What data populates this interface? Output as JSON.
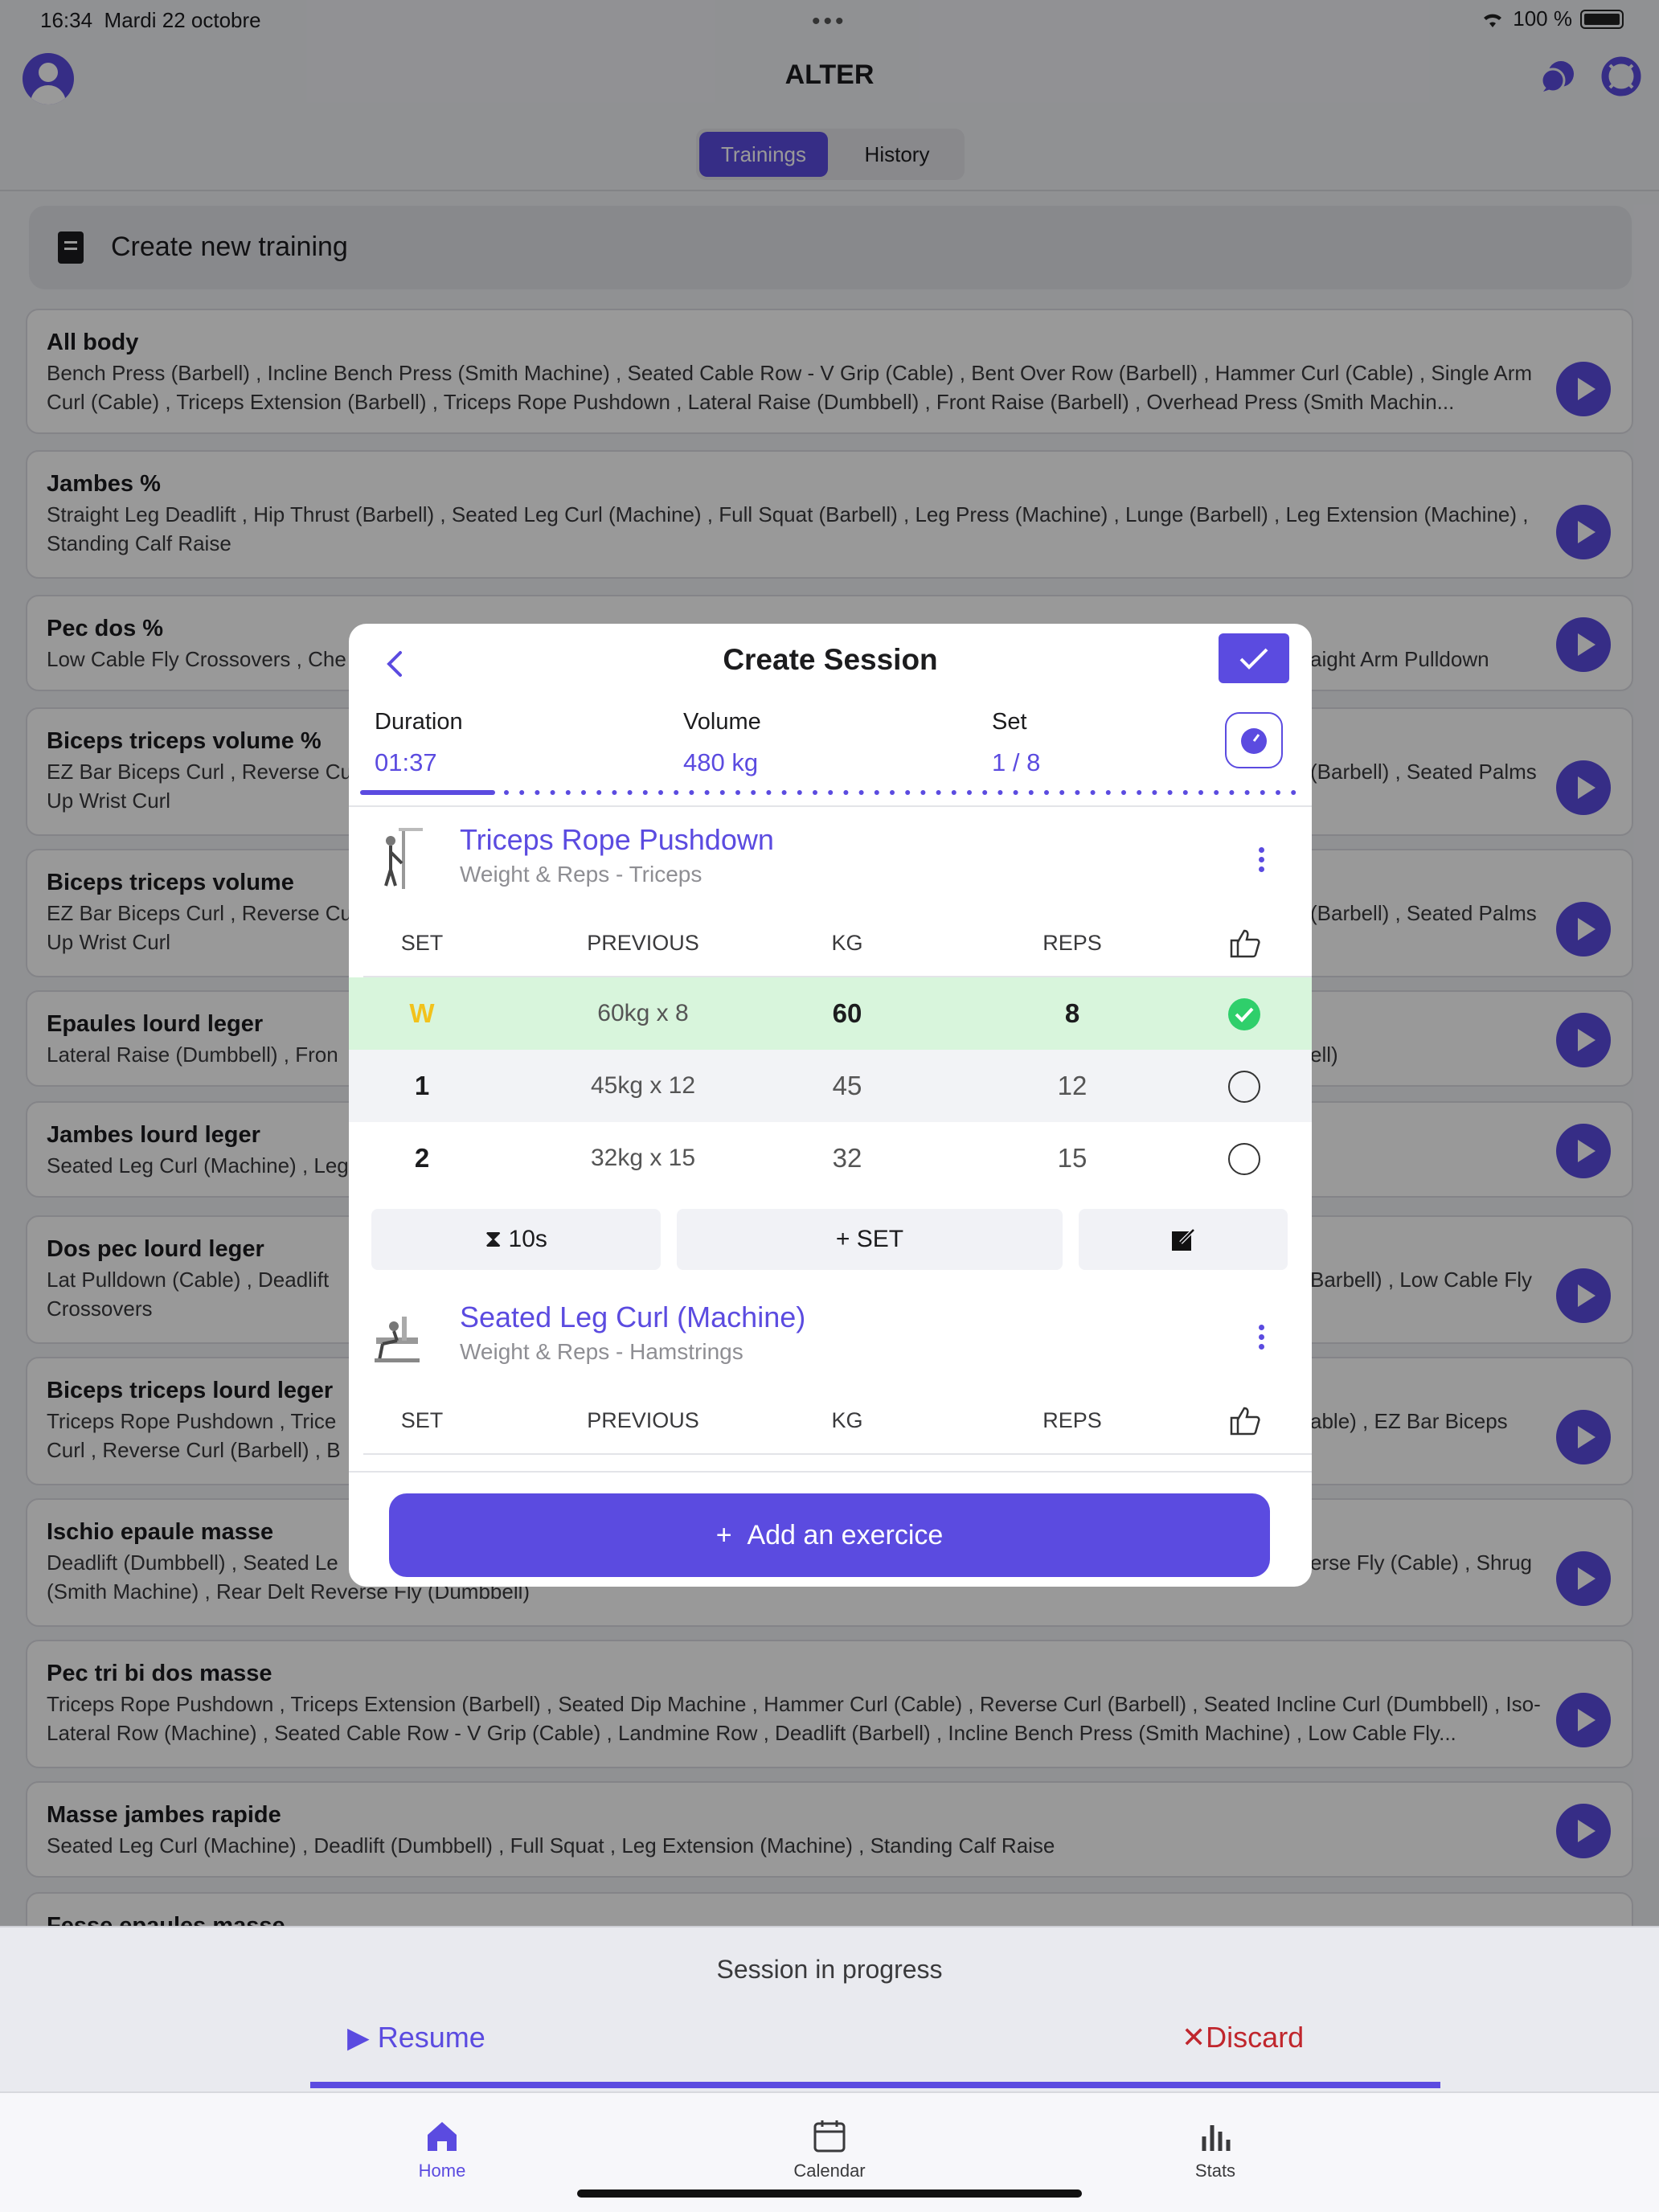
{
  "status_bar": {
    "time": "16:34",
    "date": "Mardi 22 octobre",
    "battery": "100 %"
  },
  "header": {
    "title": "ALTER",
    "tabs": [
      "Trainings",
      "History"
    ]
  },
  "create_training": "Create new training",
  "trainings": [
    {
      "name": "All body",
      "exercises": "Bench Press (Barbell) , Incline Bench Press (Smith Machine) , Seated Cable Row - V Grip (Cable) , Bent Over Row (Barbell) , Hammer Curl (Cable) , Single Arm Curl (Cable) , Triceps Extension (Barbell) , Triceps Rope Pushdown , Lateral Raise (Dumbbell) , Front Raise (Barbell) , Overhead Press (Smith Machin..."
    },
    {
      "name": "Jambes %",
      "exercises": "Straight Leg Deadlift , Hip Thrust (Barbell) , Seated Leg Curl (Machine) , Full Squat (Barbell) , Leg Press (Machine) , Lunge (Barbell) , Leg Extension (Machine) , Standing Calf Raise"
    },
    {
      "name": "Pec dos %",
      "exercises": "Low Cable Fly Crossovers , Che",
      "exercises_right": "aight Arm Pulldown"
    },
    {
      "name": "Biceps triceps volume %",
      "exercises": "EZ Bar Biceps Curl , Reverse Cu",
      "exercises_line2": "Up Wrist Curl",
      "exercises_right": "(Barbell) , Seated Palms"
    },
    {
      "name": "Biceps triceps volume",
      "exercises": "EZ Bar Biceps Curl , Reverse Cu",
      "exercises_line2": "Up Wrist Curl",
      "exercises_right": "(Barbell) , Seated Palms"
    },
    {
      "name": "Epaules lourd leger",
      "exercises": "Lateral Raise (Dumbbell) , Fron",
      "exercises_right": "ell)"
    },
    {
      "name": "Jambes lourd leger",
      "exercises": "Seated Leg Curl (Machine) , Leg"
    },
    {
      "name": "Dos pec lourd leger",
      "exercises": "Lat Pulldown (Cable) , Deadlift",
      "exercises_line2": "Crossovers",
      "exercises_right": "Barbell) , Low Cable Fly"
    },
    {
      "name": "Biceps triceps lourd leger",
      "exercises": "Triceps Rope Pushdown , Trice",
      "exercises_line2": "Curl , Reverse Curl (Barbell) , B",
      "exercises_right": "able) , EZ Bar Biceps"
    },
    {
      "name": "Ischio epaule masse",
      "exercises": "Deadlift (Dumbbell) , Seated Le",
      "exercises_line2": "(Smith Machine) , Rear Delt Reverse Fly (Dumbbell)",
      "exercises_right": "erse Fly (Cable) , Shrug"
    },
    {
      "name": "Pec tri bi dos masse",
      "exercises": "Triceps Rope Pushdown , Triceps Extension (Barbell) , Seated Dip Machine , Hammer Curl (Cable) , Reverse Curl (Barbell) , Seated Incline Curl (Dumbbell) , Iso-Lateral Row (Machine) , Seated Cable Row - V Grip (Cable) , Landmine Row , Deadlift (Barbell) , Incline Bench Press (Smith Machine) , Low Cable Fly..."
    },
    {
      "name": "Masse jambes rapide",
      "exercises": "Seated Leg Curl (Machine) , Deadlift (Dumbbell) , Full Squat , Leg Extension (Machine) , Standing Calf Raise"
    },
    {
      "name": "Fesse epaules masse",
      "exercises": ""
    }
  ],
  "modal": {
    "title": "Create Session",
    "stats": {
      "duration_label": "Duration",
      "duration_value": "01:37",
      "volume_label": "Volume",
      "volume_value": "480 kg",
      "set_label": "Set",
      "set_value": "1 / 8"
    },
    "progress": 0.125,
    "columns": {
      "set": "SET",
      "previous": "PREVIOUS",
      "kg": "KG",
      "reps": "REPS"
    },
    "exercises": [
      {
        "name": "Triceps Rope Pushdown",
        "subtitle": "Weight & Reps - Triceps",
        "sets": [
          {
            "set": "W",
            "previous": "60kg x 8",
            "kg": "60",
            "reps": "8",
            "done": true
          },
          {
            "set": "1",
            "previous": "45kg x 12",
            "kg": "45",
            "reps": "12",
            "done": false
          },
          {
            "set": "2",
            "previous": "32kg x 15",
            "kg": "32",
            "reps": "15",
            "done": false
          }
        ],
        "rest": "10s",
        "add_set": "SET"
      },
      {
        "name": "Seated Leg Curl (Machine)",
        "subtitle": "Weight & Reps - Hamstrings"
      }
    ],
    "add_exercise": "Add an exercice"
  },
  "session_sheet": {
    "title": "Session in progress",
    "resume": "Resume",
    "discard": "Discard"
  },
  "tab_bar": {
    "home": "Home",
    "calendar": "Calendar",
    "stats": "Stats"
  },
  "colors": {
    "accent": "#5b4be0",
    "success": "#2fcf6b",
    "warmup": "#f2c21b",
    "danger": "#c0262d",
    "done_row": "#d8f5dc"
  }
}
